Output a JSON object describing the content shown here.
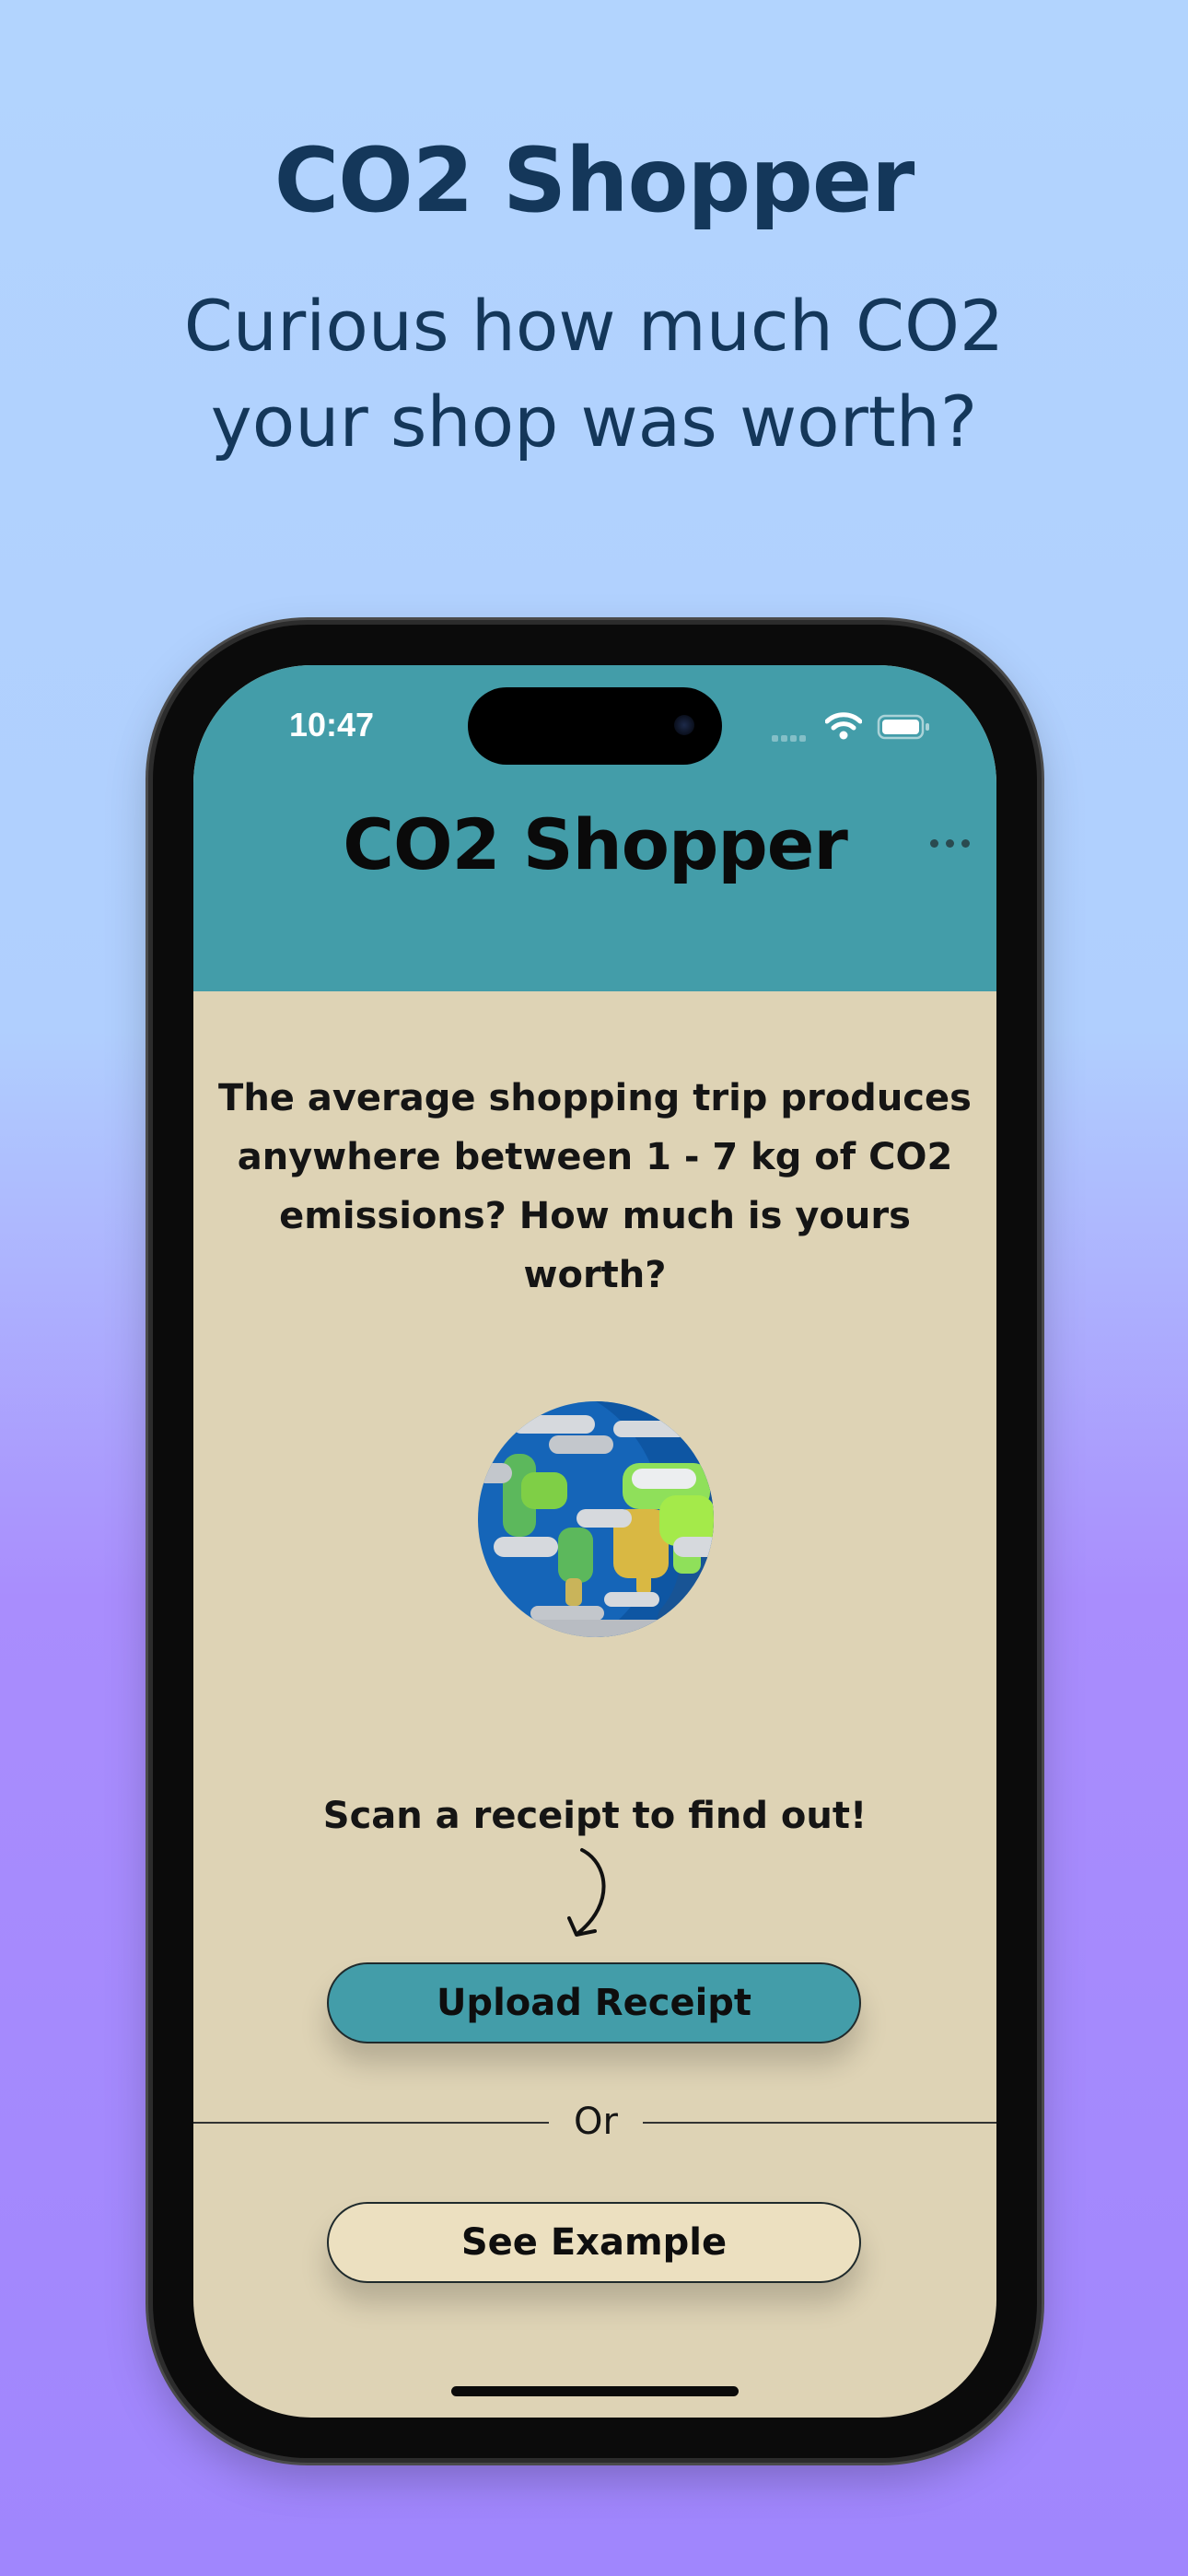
{
  "promo": {
    "title": "CO2 Shopper",
    "subtitle_line1": "Curious how much CO2",
    "subtitle_line2": "your shop was worth?"
  },
  "status_bar": {
    "time": "10:47",
    "icons": [
      "signal-icon",
      "wifi-icon",
      "battery-icon"
    ]
  },
  "app": {
    "title": "CO2 Shopper",
    "menu_icon": "ellipsis-icon",
    "intro_line1": "The average shopping trip produces",
    "intro_line2": "anywhere between 1 - 7 kg of CO2",
    "intro_line3": "emissions? How much is yours worth?",
    "illustration": "earth-globe-icon",
    "cta_text": "Scan a receipt to find out!",
    "upload_label": "Upload Receipt",
    "or_label": "Or",
    "example_label": "See Example"
  },
  "colors": {
    "background_top": "#b2d4fe",
    "background_bottom": "#a086fd",
    "header": "#439da9",
    "screen_bg": "#ded3b5",
    "title_text": "#14375a",
    "upload_button": "#439da9",
    "example_button": "#ece0c0"
  }
}
